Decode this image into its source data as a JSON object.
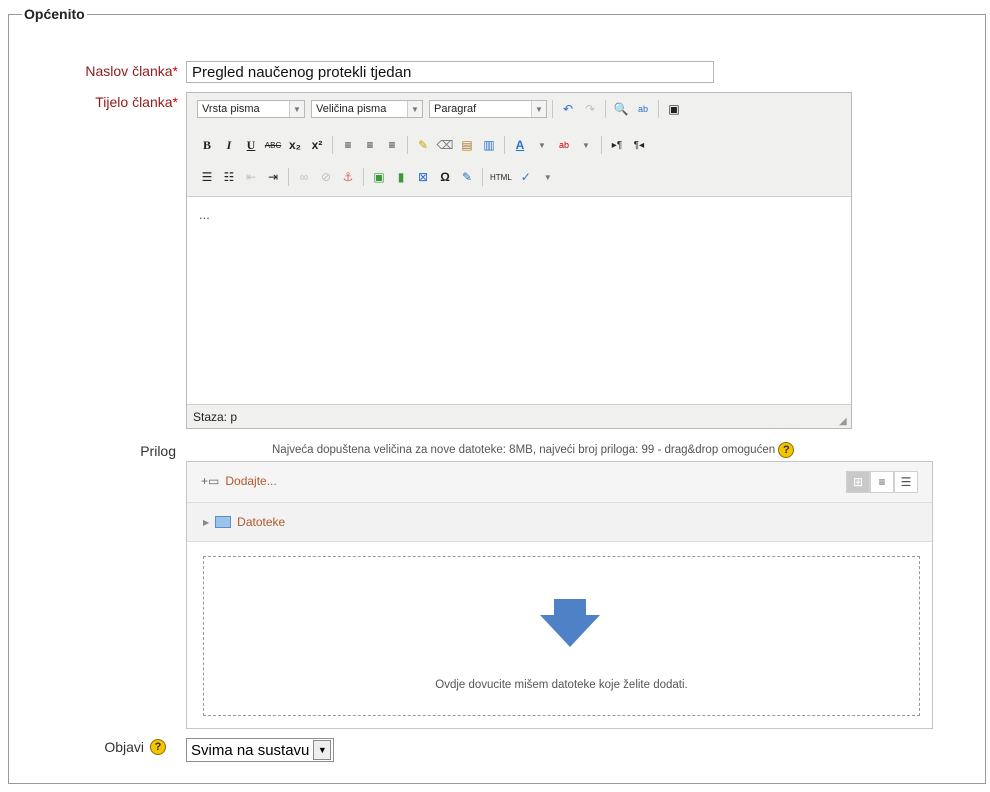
{
  "section": {
    "legend": "Općenito"
  },
  "form": {
    "title_label": "Naslov članka",
    "title_value": "Pregled naučenog protekli tjedan",
    "body_label": "Tijelo članka",
    "required_mark": "*",
    "editor": {
      "font_select": "Vrsta pisma",
      "size_select": "Veličina pisma",
      "format_select": "Paragraf",
      "content": "...",
      "status_path": "Staza: p",
      "html_label": "HTML"
    },
    "attachment_label": "Prilog",
    "attachment_info": "Najveća dopuštena veličina za nove datoteke: 8MB, najveći broj priloga: 99 - drag&drop omogućen",
    "add_label": "Dodajte...",
    "folder_label": "Datoteke",
    "drop_text": "Ovdje dovucite mišem datoteke koje želite dodati.",
    "publish_label": "Objavi",
    "publish_value": "Svima na sustavu",
    "help_mark": "?"
  },
  "colors": {
    "label": "#8e1a1a",
    "required": "#cc0000",
    "link": "#b0582a",
    "help": "#f4c400"
  }
}
